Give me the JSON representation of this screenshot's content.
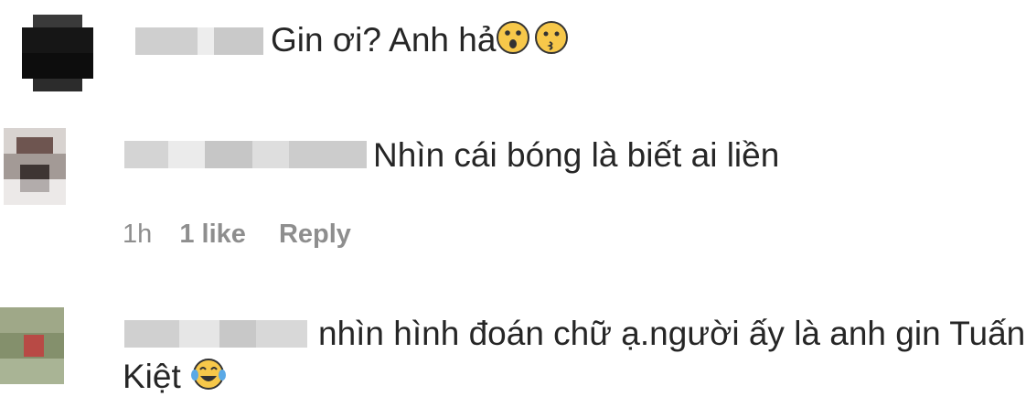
{
  "comments": [
    {
      "username_visible": false,
      "text": "Gin ơi? Anh hả",
      "emojis": [
        "hushed-face-emoji",
        "kissing-face-emoji"
      ]
    },
    {
      "username_visible": false,
      "text": "Nhìn cái bóng là biết ai liền",
      "meta": {
        "time": "1h",
        "likes": "1 like",
        "reply": "Reply"
      }
    },
    {
      "username_visible": false,
      "text_line1": "nhìn hình đoán chữ ạ.người ấy là anh gin Tuấn",
      "text_line2": "Kiệt",
      "emojis": [
        "tears-of-joy-emoji"
      ]
    }
  ],
  "colors": {
    "text": "#262626",
    "meta": "#8e8e8e",
    "emoji_yellow": "#f7c84a",
    "background": "#ffffff"
  }
}
